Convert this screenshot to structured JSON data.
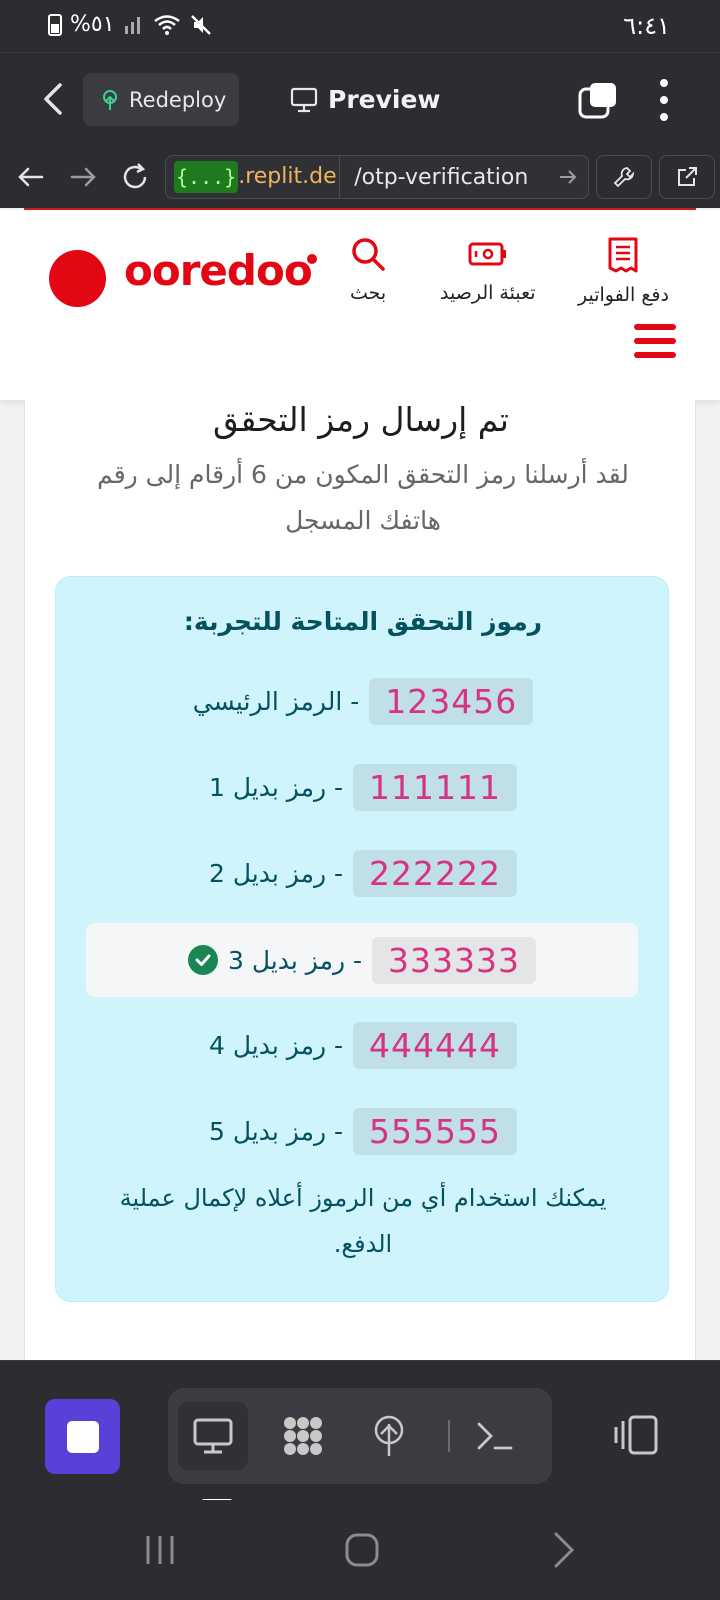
{
  "status_bar": {
    "time": "٦:٤١",
    "battery": "%٥١"
  },
  "toolbar": {
    "redeploy_label": "Redeploy",
    "preview_label": "Preview"
  },
  "url_bar": {
    "badge": "{...}",
    "domain": ".replit.de",
    "path": "/otp-verification"
  },
  "site_header": {
    "logo_text": "ooredoo",
    "nav_items": [
      {
        "label": "بحث",
        "icon": "search-icon"
      },
      {
        "label": "تعبئة الرصيد",
        "icon": "battery-recharge-icon"
      },
      {
        "label": "دفع الفواتير",
        "icon": "bill-icon"
      }
    ],
    "brand_color": "#e30613"
  },
  "otp": {
    "title": "تم إرسال رمز التحقق",
    "subtitle": "لقد أرسلنا رمز التحقق المكون من 6 أرقام إلى رقم هاتفك المسجل",
    "codes_title": "رموز التحقق المتاحة للتجربة:",
    "codes": [
      {
        "code": "123456",
        "label": "- الرمز الرئيسي",
        "selected": false
      },
      {
        "code": "111111",
        "label": "- رمز بديل 1",
        "selected": false
      },
      {
        "code": "222222",
        "label": "- رمز بديل 2",
        "selected": false
      },
      {
        "code": "333333",
        "label": "- رمز بديل 3",
        "selected": true
      },
      {
        "code": "444444",
        "label": "- رمز بديل 4",
        "selected": false
      },
      {
        "code": "555555",
        "label": "- رمز بديل 5",
        "selected": false
      }
    ],
    "footer_note": "يمكنك استخدام أي من الرموز أعلاه لإكمال عملية الدفع."
  },
  "colors": {
    "code_text": "#d63384",
    "info_bg": "#cff4fc",
    "info_text": "#055160",
    "success": "#198754",
    "stop_button": "#5b3fd9"
  }
}
